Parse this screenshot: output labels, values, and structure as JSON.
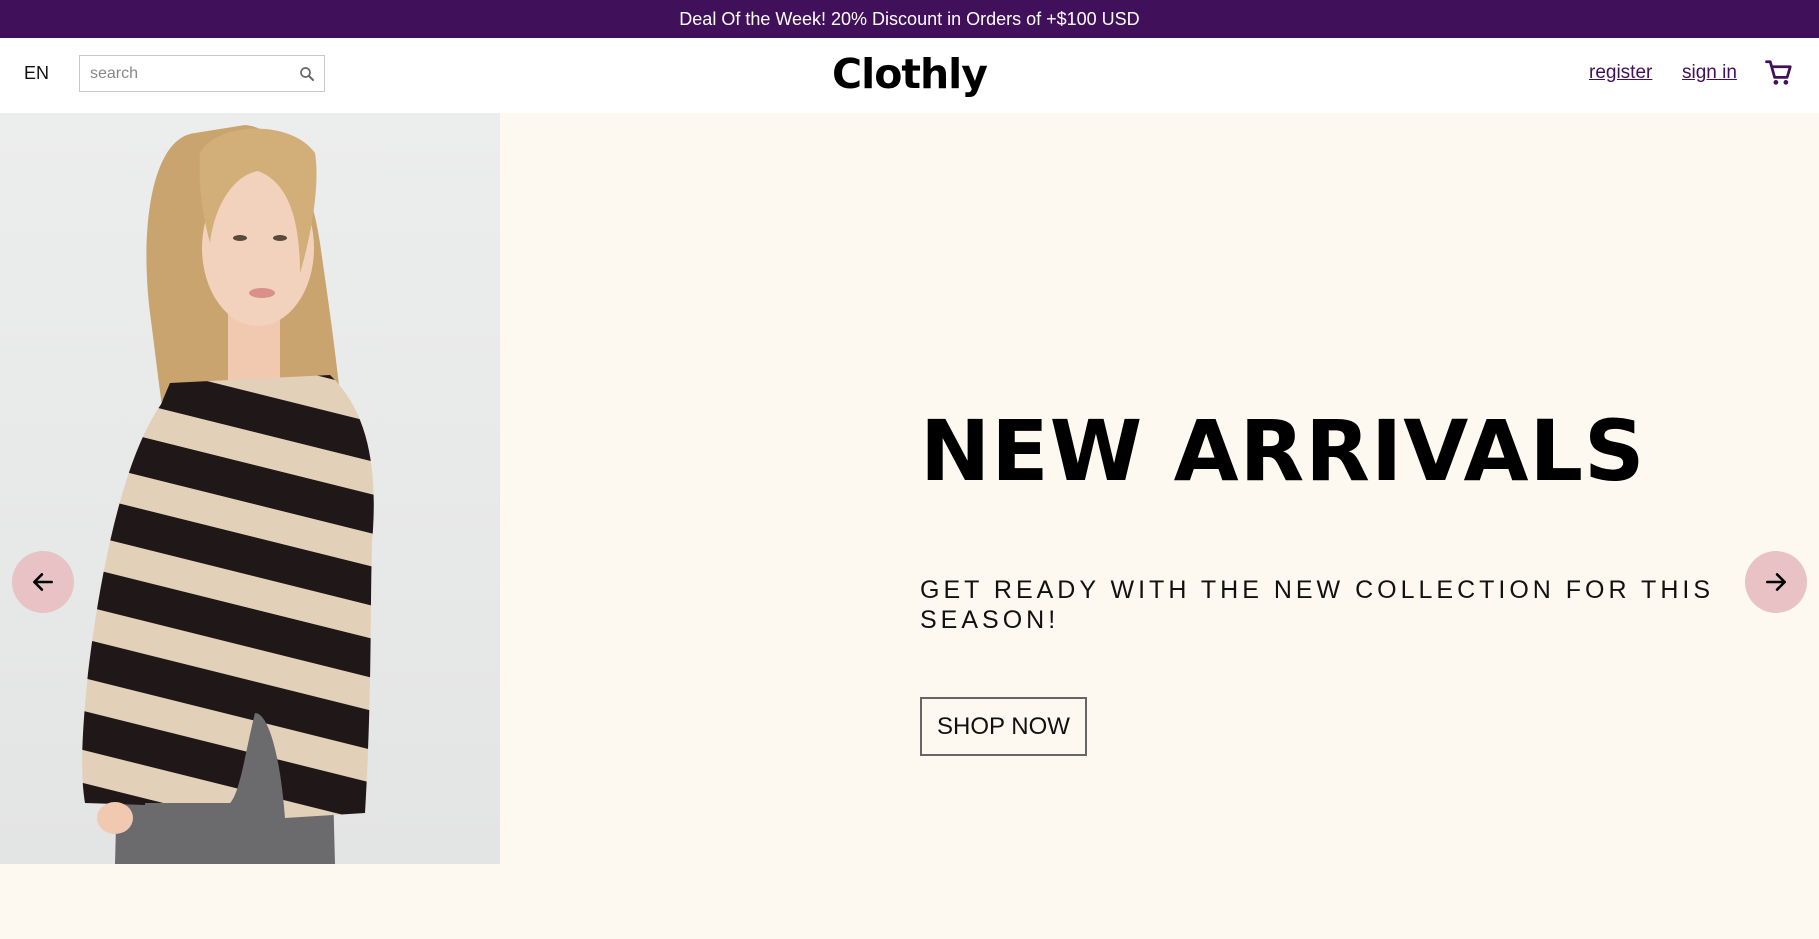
{
  "announcement": {
    "text": "Deal Of the Week! 20% Discount in Orders of +$100 USD"
  },
  "header": {
    "language": "EN",
    "search": {
      "placeholder": "search",
      "value": ""
    },
    "logo": "Clothly",
    "links": {
      "register": "register",
      "sign_in": "sign in"
    },
    "icons": {
      "search": "search-icon",
      "cart": "cart-icon"
    }
  },
  "hero": {
    "title": "NEW ARRIVALS",
    "subtitle": "GET READY WITH THE NEW COLLECTION FOR THIS SEASON!",
    "cta_label": "SHOP NOW",
    "icons": {
      "prev": "arrow-left-icon",
      "next": "arrow-right-icon"
    }
  },
  "colors": {
    "announcement_bg": "#41105a",
    "link": "#41105a",
    "page_bg": "#fdf8f0",
    "arrow_button": "#e8c2c4"
  }
}
